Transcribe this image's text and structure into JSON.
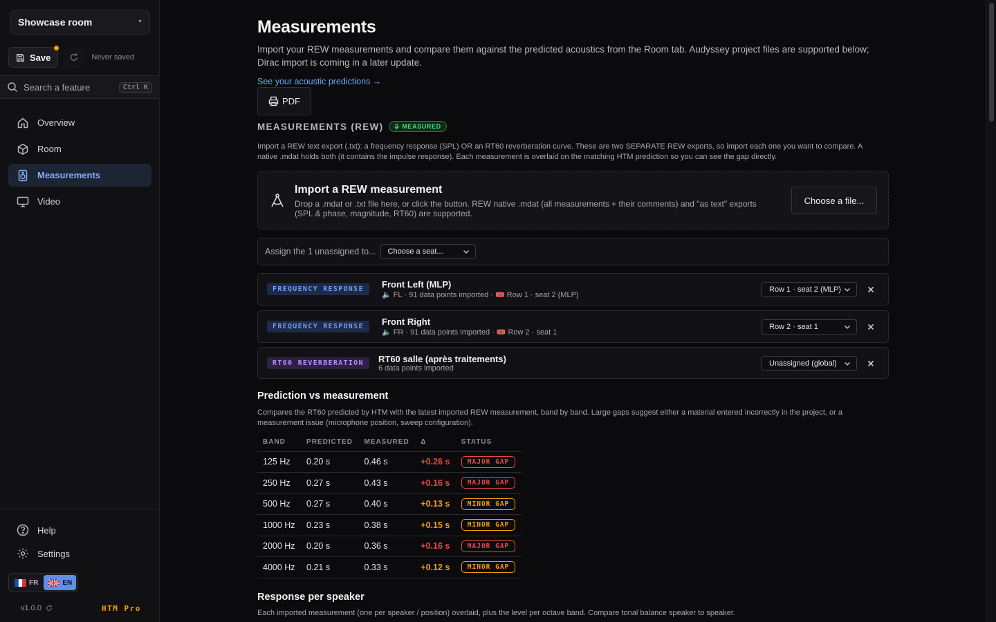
{
  "sidebar": {
    "room": "Showcase room",
    "save_label": "Save",
    "save_status": "Never saved",
    "search_placeholder": "Search a feature",
    "search_shortcut": "Ctrl K",
    "nav": [
      {
        "label": "Overview",
        "icon": "home-icon"
      },
      {
        "label": "Room",
        "icon": "cube-icon"
      },
      {
        "label": "Measurements",
        "icon": "speaker-icon",
        "active": true
      },
      {
        "label": "Video",
        "icon": "monitor-icon"
      }
    ],
    "help": "Help",
    "settings": "Settings",
    "languages": [
      "FR",
      "EN"
    ],
    "active_language": "EN",
    "version": "v1.0.0",
    "edition": "HTM Pro"
  },
  "page": {
    "title": "Measurements",
    "intro": "Import your REW measurements and compare them against the predicted acoustics from the Room tab. Audyssey project files are supported below; Dirac import is coming in a later update.",
    "predictions_link": "See your acoustic predictions →",
    "pdf_label": "PDF"
  },
  "rew": {
    "title": "MEASUREMENTS (REW)",
    "badge": "MEASURED",
    "description": "Import a REW text export (.txt): a frequency response (SPL) OR an RT60 reverberation curve. These are two SEPARATE REW exports, so import each one you want to compare. A native .mdat holds both (it contains the impulse response). Each measurement is overlaid on the matching HTM prediction so you can see the gap directly.",
    "import_title": "Import a REW measurement",
    "import_desc": "Drop a .mdat or .txt file here, or click the button. REW native .mdat (all measurements + their comments) and \"as text\" exports (SPL & phase, magnitude, RT60) are supported.",
    "choose_label": "Choose a file...",
    "assign_label": "Assign the 1 unassigned to...",
    "assign_select": "Choose a seat...",
    "measurements": [
      {
        "tag": "FREQUENCY RESPONSE",
        "title": "Front Left (MLP)",
        "speaker": "FL",
        "points": "· 91 data points imported ·",
        "seat": "Row 1 · seat 2 (MLP)",
        "select": "Row 1 · seat 2 (MLP)"
      },
      {
        "tag": "FREQUENCY RESPONSE",
        "title": "Front Right",
        "speaker": "FR",
        "points": "· 91 data points imported ·",
        "seat": "Row 2 · seat 1",
        "select": "Row 2 · seat 1"
      },
      {
        "tag": "RT60 REVERBERATION",
        "title": "RT60 salle (après traitements)",
        "points": "6 data points imported",
        "select": "Unassigned (global)"
      }
    ]
  },
  "comparison": {
    "title": "Prediction vs measurement",
    "description": "Compares the RT60 predicted by HTM with the latest imported REW measurement, band by band. Large gaps suggest either a material entered incorrectly in the project, or a measurement issue (microphone position, sweep configuration).",
    "headers": [
      "BAND",
      "PREDICTED",
      "MEASURED",
      "Δ",
      "STATUS"
    ],
    "rows": [
      {
        "band": "125 Hz",
        "predicted": "0.20 s",
        "measured": "0.46 s",
        "delta": "+0.26 s",
        "status": "MAJOR GAP",
        "level": "major"
      },
      {
        "band": "250 Hz",
        "predicted": "0.27 s",
        "measured": "0.43 s",
        "delta": "+0.16 s",
        "status": "MAJOR GAP",
        "level": "major"
      },
      {
        "band": "500 Hz",
        "predicted": "0.27 s",
        "measured": "0.40 s",
        "delta": "+0.13 s",
        "status": "MINOR GAP",
        "level": "minor"
      },
      {
        "band": "1000 Hz",
        "predicted": "0.23 s",
        "measured": "0.38 s",
        "delta": "+0.15 s",
        "status": "MINOR GAP",
        "level": "minor"
      },
      {
        "band": "2000 Hz",
        "predicted": "0.20 s",
        "measured": "0.36 s",
        "delta": "+0.16 s",
        "status": "MAJOR GAP",
        "level": "major"
      },
      {
        "band": "4000 Hz",
        "predicted": "0.21 s",
        "measured": "0.33 s",
        "delta": "+0.12 s",
        "status": "MINOR GAP",
        "level": "minor"
      }
    ]
  },
  "per_speaker": {
    "title": "Response per speaker",
    "description": "Each imported measurement (one per speaker / position) overlaid, plus the level per octave band. Compare tonal balance speaker to speaker."
  },
  "colors": {
    "accent": "#6aa6ff",
    "major": "#ef4444",
    "minor": "#f59e0b",
    "measured": "#4ade80",
    "pro": "#f59e0b"
  }
}
